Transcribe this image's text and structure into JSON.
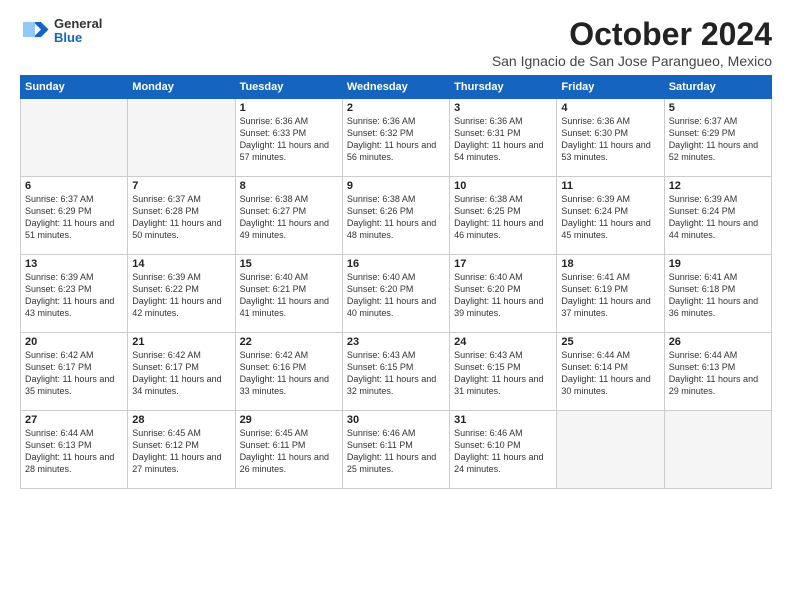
{
  "logo": {
    "general": "General",
    "blue": "Blue"
  },
  "title": "October 2024",
  "subtitle": "San Ignacio de San Jose Parangueo, Mexico",
  "header_days": [
    "Sunday",
    "Monday",
    "Tuesday",
    "Wednesday",
    "Thursday",
    "Friday",
    "Saturday"
  ],
  "weeks": [
    [
      {
        "num": "",
        "info": ""
      },
      {
        "num": "",
        "info": ""
      },
      {
        "num": "1",
        "info": "Sunrise: 6:36 AM\nSunset: 6:33 PM\nDaylight: 11 hours and 57 minutes."
      },
      {
        "num": "2",
        "info": "Sunrise: 6:36 AM\nSunset: 6:32 PM\nDaylight: 11 hours and 56 minutes."
      },
      {
        "num": "3",
        "info": "Sunrise: 6:36 AM\nSunset: 6:31 PM\nDaylight: 11 hours and 54 minutes."
      },
      {
        "num": "4",
        "info": "Sunrise: 6:36 AM\nSunset: 6:30 PM\nDaylight: 11 hours and 53 minutes."
      },
      {
        "num": "5",
        "info": "Sunrise: 6:37 AM\nSunset: 6:29 PM\nDaylight: 11 hours and 52 minutes."
      }
    ],
    [
      {
        "num": "6",
        "info": "Sunrise: 6:37 AM\nSunset: 6:29 PM\nDaylight: 11 hours and 51 minutes."
      },
      {
        "num": "7",
        "info": "Sunrise: 6:37 AM\nSunset: 6:28 PM\nDaylight: 11 hours and 50 minutes."
      },
      {
        "num": "8",
        "info": "Sunrise: 6:38 AM\nSunset: 6:27 PM\nDaylight: 11 hours and 49 minutes."
      },
      {
        "num": "9",
        "info": "Sunrise: 6:38 AM\nSunset: 6:26 PM\nDaylight: 11 hours and 48 minutes."
      },
      {
        "num": "10",
        "info": "Sunrise: 6:38 AM\nSunset: 6:25 PM\nDaylight: 11 hours and 46 minutes."
      },
      {
        "num": "11",
        "info": "Sunrise: 6:39 AM\nSunset: 6:24 PM\nDaylight: 11 hours and 45 minutes."
      },
      {
        "num": "12",
        "info": "Sunrise: 6:39 AM\nSunset: 6:24 PM\nDaylight: 11 hours and 44 minutes."
      }
    ],
    [
      {
        "num": "13",
        "info": "Sunrise: 6:39 AM\nSunset: 6:23 PM\nDaylight: 11 hours and 43 minutes."
      },
      {
        "num": "14",
        "info": "Sunrise: 6:39 AM\nSunset: 6:22 PM\nDaylight: 11 hours and 42 minutes."
      },
      {
        "num": "15",
        "info": "Sunrise: 6:40 AM\nSunset: 6:21 PM\nDaylight: 11 hours and 41 minutes."
      },
      {
        "num": "16",
        "info": "Sunrise: 6:40 AM\nSunset: 6:20 PM\nDaylight: 11 hours and 40 minutes."
      },
      {
        "num": "17",
        "info": "Sunrise: 6:40 AM\nSunset: 6:20 PM\nDaylight: 11 hours and 39 minutes."
      },
      {
        "num": "18",
        "info": "Sunrise: 6:41 AM\nSunset: 6:19 PM\nDaylight: 11 hours and 37 minutes."
      },
      {
        "num": "19",
        "info": "Sunrise: 6:41 AM\nSunset: 6:18 PM\nDaylight: 11 hours and 36 minutes."
      }
    ],
    [
      {
        "num": "20",
        "info": "Sunrise: 6:42 AM\nSunset: 6:17 PM\nDaylight: 11 hours and 35 minutes."
      },
      {
        "num": "21",
        "info": "Sunrise: 6:42 AM\nSunset: 6:17 PM\nDaylight: 11 hours and 34 minutes."
      },
      {
        "num": "22",
        "info": "Sunrise: 6:42 AM\nSunset: 6:16 PM\nDaylight: 11 hours and 33 minutes."
      },
      {
        "num": "23",
        "info": "Sunrise: 6:43 AM\nSunset: 6:15 PM\nDaylight: 11 hours and 32 minutes."
      },
      {
        "num": "24",
        "info": "Sunrise: 6:43 AM\nSunset: 6:15 PM\nDaylight: 11 hours and 31 minutes."
      },
      {
        "num": "25",
        "info": "Sunrise: 6:44 AM\nSunset: 6:14 PM\nDaylight: 11 hours and 30 minutes."
      },
      {
        "num": "26",
        "info": "Sunrise: 6:44 AM\nSunset: 6:13 PM\nDaylight: 11 hours and 29 minutes."
      }
    ],
    [
      {
        "num": "27",
        "info": "Sunrise: 6:44 AM\nSunset: 6:13 PM\nDaylight: 11 hours and 28 minutes."
      },
      {
        "num": "28",
        "info": "Sunrise: 6:45 AM\nSunset: 6:12 PM\nDaylight: 11 hours and 27 minutes."
      },
      {
        "num": "29",
        "info": "Sunrise: 6:45 AM\nSunset: 6:11 PM\nDaylight: 11 hours and 26 minutes."
      },
      {
        "num": "30",
        "info": "Sunrise: 6:46 AM\nSunset: 6:11 PM\nDaylight: 11 hours and 25 minutes."
      },
      {
        "num": "31",
        "info": "Sunrise: 6:46 AM\nSunset: 6:10 PM\nDaylight: 11 hours and 24 minutes."
      },
      {
        "num": "",
        "info": ""
      },
      {
        "num": "",
        "info": ""
      }
    ]
  ]
}
